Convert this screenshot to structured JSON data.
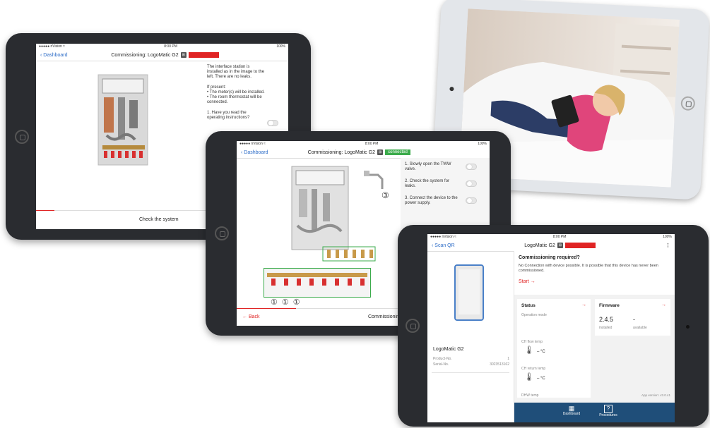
{
  "colors": {
    "accent": "#e02424",
    "connected": "#3bab4b",
    "link": "#2b6bc7",
    "tabbar": "#1f4e79"
  },
  "tablet1": {
    "status": {
      "carrier": "●●●●● nVision ≈",
      "time": "8:00 PM",
      "battery": "100%"
    },
    "back": "Dashboard",
    "title": "Commissioning: LogoMatic G2",
    "badge": "disconnected",
    "paragraph": "The interface station is installed as in the image to the left. There are no leaks.",
    "ifPresent": "If present:",
    "bullet1": "• The meter(s) will be installed.",
    "bullet2": "• The room thermostat will be connected.",
    "question": "1. Have you read the operating instructions?",
    "footer": "Check the system"
  },
  "tablet2": {
    "status": {
      "carrier": "●●●●● nVision ≈",
      "time": "8:00 PM",
      "battery": "100%"
    },
    "back": "Dashboard",
    "title": "Commissioning: LogoMatic G2",
    "badge": "connected",
    "steps": [
      "1. Slowly open the TWW valve.",
      "2. Check the system for leaks.",
      "3. Connect the device to the power supply."
    ],
    "footerBack": "← Back",
    "footer": "Commissioning the WS",
    "callouts": [
      "①",
      "①",
      "①",
      "③"
    ]
  },
  "tablet3": {
    "status": {
      "carrier": "●●●●● nVision ≈",
      "time": "8:00 PM",
      "battery": "100%"
    },
    "back": "Scan QR",
    "title": "LogoMatic G2",
    "badge": "disconnected",
    "device": {
      "name": "LogoMatic G2",
      "productLabel": "Product-No.",
      "productValue": "1",
      "serialLabel": "Serial-No.",
      "serialValue": "3023513162"
    },
    "commissioning": {
      "title": "Commissioning required?",
      "body": "No Connection with device possible. It is possible that this device has never been commissioned.",
      "start": "Start →"
    },
    "statusCard": {
      "title": "Status",
      "arrow": "→",
      "mode": "Operation mode"
    },
    "firmwareCard": {
      "title": "Firmware",
      "arrow": "→",
      "installed": "2.4.5",
      "installedLabel": "installed",
      "available": "-",
      "availableLabel": "available"
    },
    "temps": [
      {
        "label": "CH flow temp",
        "value": "– °C"
      },
      {
        "label": "CH return temp",
        "value": "– °C"
      },
      {
        "label": "DHW temp",
        "value": ""
      }
    ],
    "version": "App version: v3.0.41",
    "tabs": [
      {
        "icon": "▦",
        "label": "Dashboard"
      },
      {
        "icon": "?",
        "label": "Procedures"
      }
    ]
  }
}
